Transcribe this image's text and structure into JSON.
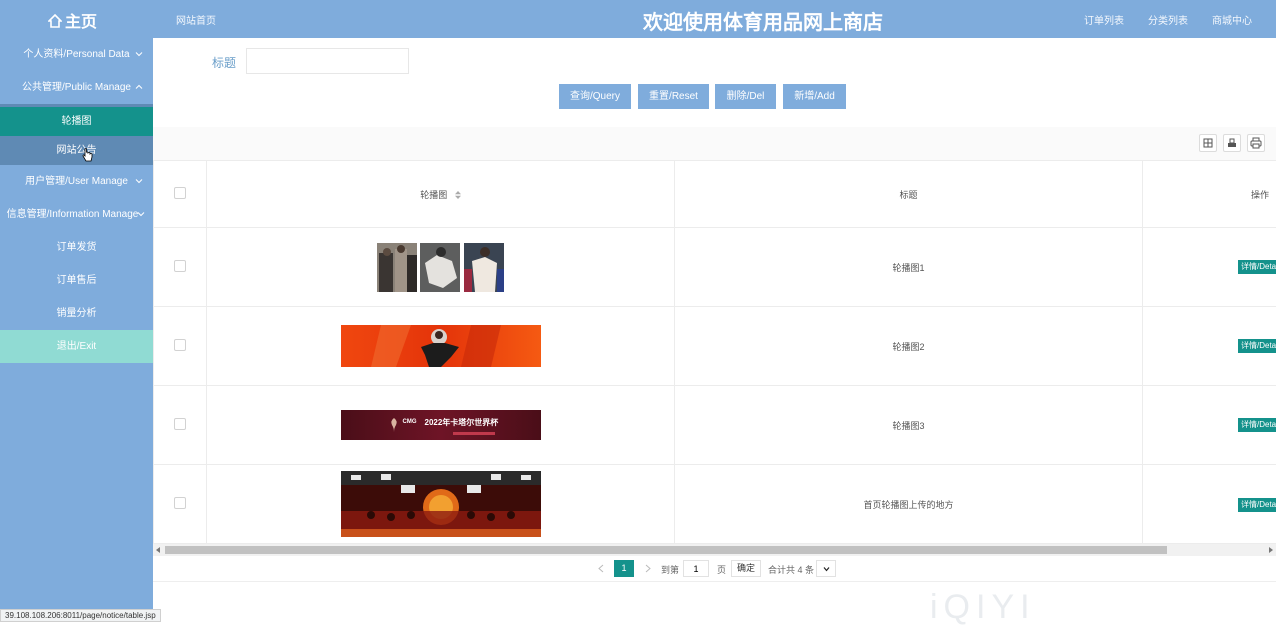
{
  "header": {
    "home_label": "主页",
    "site_link": "网站首页",
    "title": "欢迎使用体育用品网上商店",
    "links": [
      "订单列表",
      "分类列表",
      "商城中心"
    ]
  },
  "sidebar": {
    "items": [
      {
        "label": "个人资料/Personal Data"
      },
      {
        "label": "公共管理/Public Manage"
      },
      {
        "label": "轮播图"
      },
      {
        "label": "网站公告"
      },
      {
        "label": "用户管理/User Manage"
      },
      {
        "label": "信息管理/Information Manage"
      },
      {
        "label": "订单发货"
      },
      {
        "label": "订单售后"
      },
      {
        "label": "销量分析"
      },
      {
        "label": "退出/Exit"
      }
    ]
  },
  "search": {
    "label": "标题",
    "value": ""
  },
  "buttons": {
    "query": "查询/Query",
    "reset": "重置/Reset",
    "delete": "删除/Del",
    "add": "新增/Add"
  },
  "table": {
    "columns": [
      "轮播图",
      "标题",
      "操作"
    ],
    "rows": [
      {
        "title": "轮播图1",
        "action": "详情/Deta"
      },
      {
        "title": "轮播图2",
        "action": "详情/Deta"
      },
      {
        "title": "轮播图3",
        "action": "详情/Deta"
      },
      {
        "title": "首页轮播图上传的地方",
        "action": "详情/Deta"
      }
    ],
    "banner3_text": "2022年卡塔尔世界杯",
    "banner3_logo": "CMG"
  },
  "pagination": {
    "current": "1",
    "goto_label": "到第",
    "goto_value": "1",
    "page_unit": "页",
    "confirm": "确定",
    "total": "合计共 4 条"
  },
  "status_url": "39.108.108.206:8011/page/notice/table.jsp",
  "watermark": "iQIYI",
  "colors": {
    "primary": "#7facdc",
    "accent": "#14928c",
    "exit": "#90dbd3"
  }
}
